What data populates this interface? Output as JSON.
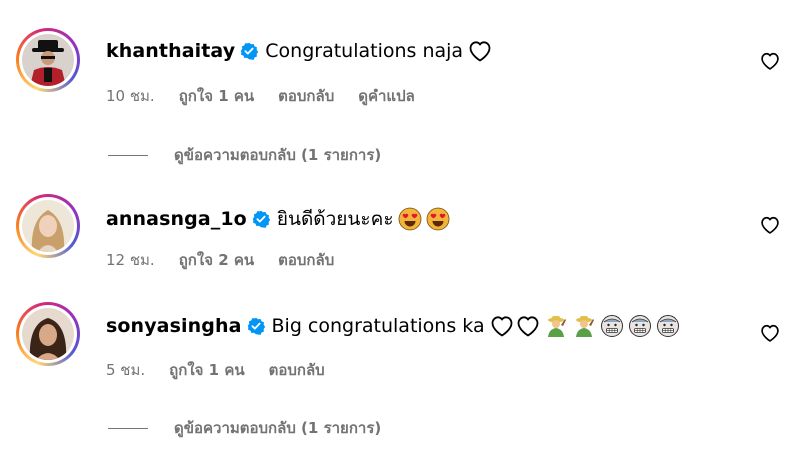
{
  "comments": [
    {
      "username": "khanthaitay",
      "verified": true,
      "text": "Congratulations naja",
      "trailing_icons": [
        "outline-heart"
      ],
      "time": "10 ชม.",
      "likes": "ถูกใจ 1 คน",
      "reply_label": "ตอบกลับ",
      "translate_label": "ดูคำแปล",
      "view_replies": "ดูข้อความตอบกลับ (1 รายการ)",
      "avatar_icon": "avatar-man-in-red-hat"
    },
    {
      "username": "annasnga_1o",
      "verified": true,
      "text": "ยินดีด้วยนะคะ",
      "trailing_icons": [
        "heart-eyes-emoji",
        "heart-eyes-emoji"
      ],
      "time": "12 ชม.",
      "likes": "ถูกใจ 2 คน",
      "reply_label": "ตอบกลับ",
      "avatar_icon": "avatar-woman-blonde"
    },
    {
      "username": "sonyasingha",
      "verified": true,
      "text": "Big congratulations ka",
      "trailing_icons": [
        "outline-heart",
        "outline-heart",
        "farmer-emoji",
        "farmer-emoji",
        "grimacing-face-emoji",
        "grimacing-face-emoji",
        "grimacing-face-emoji"
      ],
      "time": "5 ชม.",
      "likes": "ถูกใจ 1 คน",
      "reply_label": "ตอบกลับ",
      "view_replies": "ดูข้อความตอบกลับ (1 รายการ)",
      "avatar_icon": "avatar-woman-dark-hair"
    }
  ],
  "colors": {
    "text": "#000000",
    "secondary": "#737373",
    "verified_blue": "#0095f6"
  }
}
